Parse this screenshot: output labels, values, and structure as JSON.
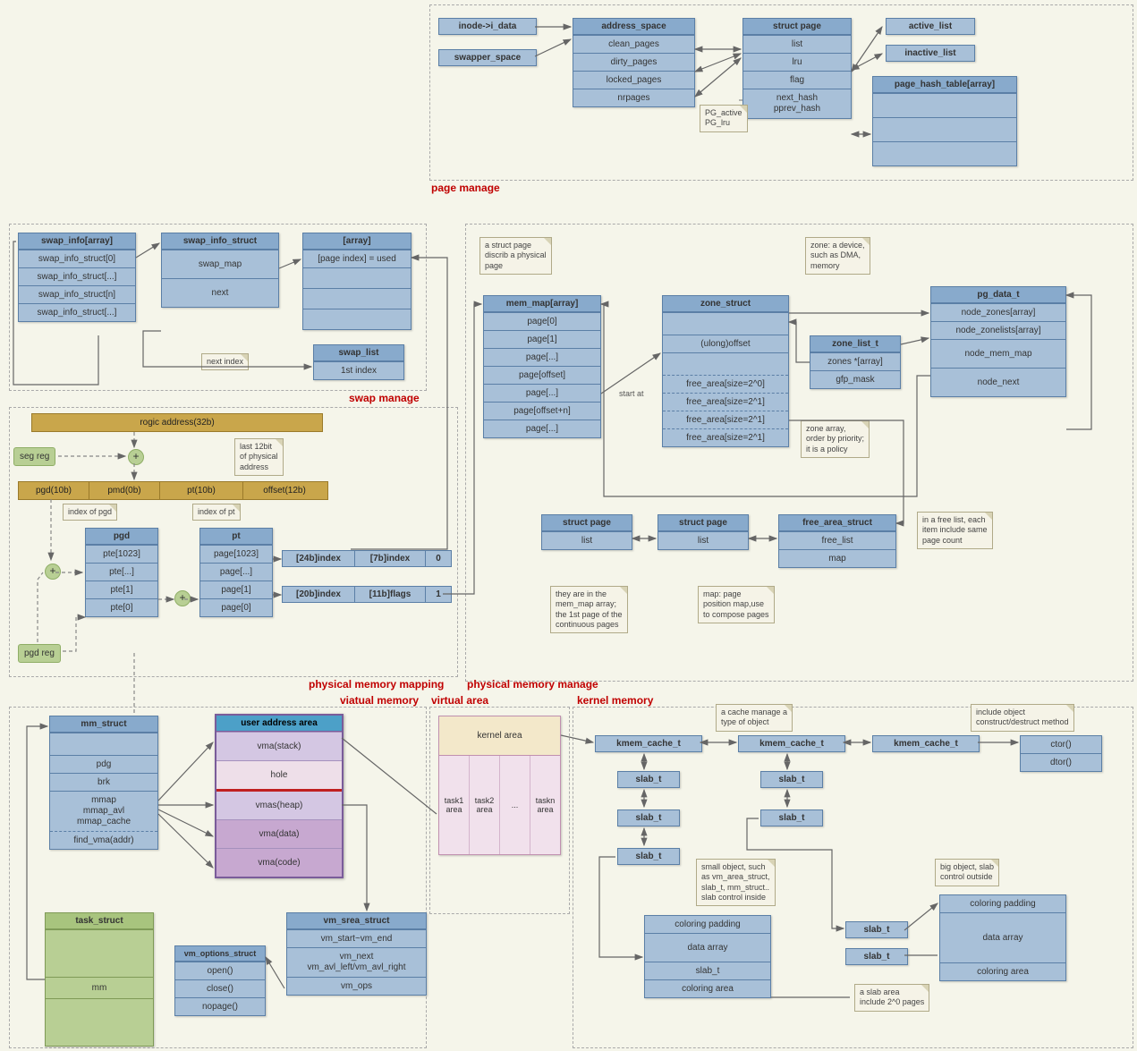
{
  "regions": {
    "page_manage": "page manage",
    "swap_manage": "swap manage",
    "phys_mapping": "physical memory mapping",
    "phys_manage": "physical memory manage",
    "virtual_mem": "viatual memory",
    "virtual_area": "virtual area",
    "kernel_mem": "kernel memory"
  },
  "page_manage": {
    "inode": "inode->i_data",
    "swapper_space": "swapper_space",
    "address_space": {
      "title": "address_space",
      "rows": [
        "clean_pages",
        "dirty_pages",
        "locked_pages",
        "nrpages"
      ]
    },
    "struct_page": {
      "title": "struct page",
      "rows": [
        "list",
        "lru",
        "flag",
        "next_hash\npprev_hash"
      ]
    },
    "active_list": "active_list",
    "inactive_list": "inactive_list",
    "page_hash_table": {
      "title": "page_hash_table[array]"
    },
    "pg_note": "PG_active\nPG_lru"
  },
  "swap_manage": {
    "swap_info_array": {
      "title": "swap_info[array]",
      "rows": [
        "swap_info_struct[0]",
        "swap_info_struct[...]",
        "swap_info_struct[n]",
        "swap_info_struct[...]"
      ]
    },
    "swap_info_struct": {
      "title": "swap_info_struct",
      "rows": [
        "swap_map",
        "next"
      ]
    },
    "array_box": {
      "title": "[array]",
      "rows": [
        "[page index] = used"
      ]
    },
    "swap_list": {
      "title": "swap_list",
      "rows": [
        "1st index"
      ]
    },
    "next_note": "next index"
  },
  "phys_mapping": {
    "rogic": "rogic address(32b)",
    "seg_reg": "seg reg",
    "pgd_reg": "pgd reg",
    "row_headers": [
      "pgd(10b)",
      "pmd(0b)",
      "pt(10b)",
      "offset(12b)"
    ],
    "note_pgd": "index of pgd",
    "note_pt": "index of pt",
    "note_last12": "last 12bit\nof physical\naddress",
    "pgd": {
      "title": "pgd",
      "rows": [
        "pte[1023]",
        "pte[...]",
        "pte[1]",
        "pte[0]"
      ]
    },
    "pt": {
      "title": "pt",
      "rows": [
        "page[1023]",
        "page[...]",
        "page[1]",
        "page[0]"
      ]
    },
    "bit_row1": [
      "[24b]index",
      "[7b]index",
      "0"
    ],
    "bit_row2": [
      "[20b]index",
      "[11b]flags",
      "1"
    ]
  },
  "phys_manage": {
    "note_sp": "a struct page\ndiscrib a physical\npage",
    "mem_map": {
      "title": "mem_map[array]",
      "rows": [
        "page[0]",
        "page[1]",
        "page[...]",
        "page[offset]",
        "page[...]",
        "page[offset+n]",
        "page[...]"
      ]
    },
    "zone_struct": {
      "title": "zone_struct",
      "rows": [
        "(ulong)offset",
        "free_area[size=2^0]",
        "free_area[size=2^1]",
        "free_area[size=2^1]",
        "free_area[size=2^1]"
      ]
    },
    "note_zone": "zone: a device,\nsuch as DMA,\nmemory",
    "zone_list": {
      "title": "zone_list_t",
      "rows": [
        "zones *[array]",
        "gfp_mask"
      ]
    },
    "note_zarr": "zone array,\norder by priority;\nit is a policy",
    "pg_data_t": {
      "title": "pg_data_t",
      "rows": [
        "node_zones[array]",
        "node_zonelists[array]",
        "node_mem_map",
        "node_next"
      ]
    },
    "start_at": "start at",
    "sp1": {
      "title": "struct page",
      "rows": [
        "list"
      ]
    },
    "sp2": {
      "title": "struct page",
      "rows": [
        "list"
      ]
    },
    "free_area_struct": {
      "title": "free_area_struct",
      "rows": [
        "free_list",
        "map"
      ]
    },
    "note_free": "in a free list, each\nitem include same\npage count",
    "note_inmap": "they are in the\nmem_map array;\nthe 1st page of the\ncontinuous pages",
    "note_map": "map: page\nposition map,use\nto compose pages"
  },
  "virtual_memory": {
    "mm_struct": {
      "title": "mm_struct",
      "rows": [
        "pdg",
        "brk",
        "mmap\nmmap_avl\nmmap_cache",
        "find_vma(addr)"
      ]
    },
    "user_area": {
      "title": "user address area",
      "segments": [
        "vma(stack)",
        "hole",
        "vmas(heap)",
        "vma(data)",
        "vma(code)"
      ]
    },
    "vm_area_struct": {
      "title": "vm_srea_struct",
      "rows": [
        "vm_start~vm_end",
        "vm_next\nvm_avl_left/vm_avl_right",
        "vm_ops"
      ]
    },
    "vm_options_struct": {
      "title": "vm_options_struct",
      "rows": [
        "open()",
        "close()",
        "nopage()"
      ]
    },
    "task_struct": {
      "title": "task_struct",
      "rows": [
        "mm"
      ]
    }
  },
  "virtual_area": {
    "kernel_area": "kernel area",
    "cols": [
      "task1\narea",
      "task2\narea",
      "...",
      "taskn\narea"
    ]
  },
  "kernel_memory": {
    "kmem": "kmem_cache_t",
    "note_cache": "a cache manage a\ntype of object",
    "note_ctor": "include object\nconstruct/destruct method",
    "ctor": "ctor()",
    "dtor": "dtor()",
    "slab_t": "slab_t",
    "note_small": "small object, such\nas vm_area_struct,\nslab_t, mm_struct..\nslab control inside",
    "note_big": "big object, slab\ncontrol outside",
    "note_slabs": "a slab area\ninclude 2^0 pages",
    "slab_box1": {
      "rows": [
        "coloring padding",
        "data array",
        "slab_t",
        "coloring area"
      ]
    },
    "slab_box2": {
      "rows": [
        "coloring padding",
        "data array",
        "coloring area"
      ]
    }
  }
}
